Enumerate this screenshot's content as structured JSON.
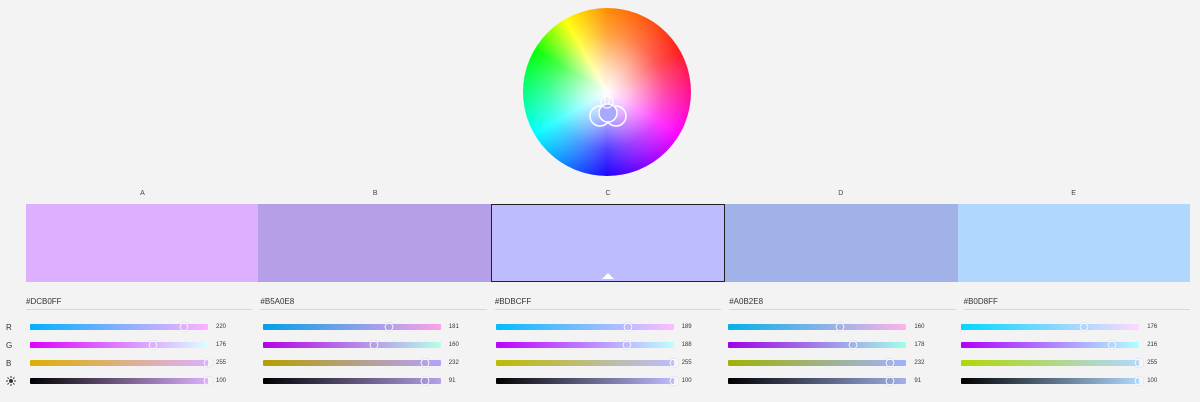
{
  "icons": {
    "harmony_handles": "color-wheel-handles-icon",
    "brightness": "sun-icon"
  },
  "columns": [
    {
      "label": "A",
      "hex": "#DCB0FF",
      "r": 220,
      "g": 176,
      "b": 255,
      "brightness": 100
    },
    {
      "label": "B",
      "hex": "#B5A0E8",
      "r": 181,
      "g": 160,
      "b": 232,
      "brightness": 91
    },
    {
      "label": "C",
      "hex": "#BDBCFF",
      "r": 189,
      "g": 188,
      "b": 255,
      "brightness": 100,
      "selected": true
    },
    {
      "label": "D",
      "hex": "#A0B2E8",
      "r": 160,
      "g": 178,
      "b": 232,
      "brightness": 91
    },
    {
      "label": "E",
      "hex": "#B0D8FF",
      "r": 176,
      "g": 216,
      "b": 255,
      "brightness": 100
    }
  ],
  "row_labels": [
    "R",
    "G",
    "B"
  ]
}
